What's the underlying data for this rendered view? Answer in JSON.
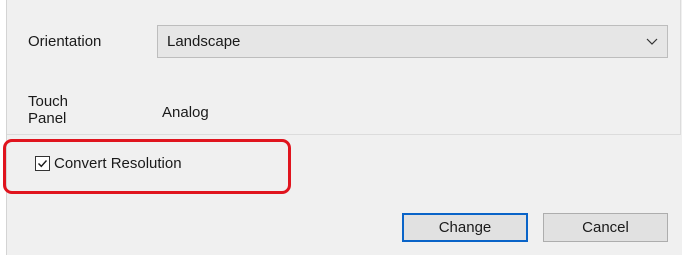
{
  "settings": {
    "orientation_label": "Orientation",
    "orientation_value": "Landscape",
    "touch_panel_label_line1": "Touch",
    "touch_panel_label_line2": "Panel",
    "touch_panel_value": "Analog"
  },
  "convert_resolution": {
    "label": "Convert Resolution",
    "checked": true
  },
  "buttons": {
    "change_label": "Change",
    "cancel_label": "Cancel"
  },
  "colors": {
    "highlight": "#e0141e",
    "default_button_border": "#0a64c8",
    "dialog_background": "#f0f0f0"
  },
  "icons": {
    "dropdown": "chevron-down-icon",
    "checkbox_mark": "checkmark-icon"
  }
}
